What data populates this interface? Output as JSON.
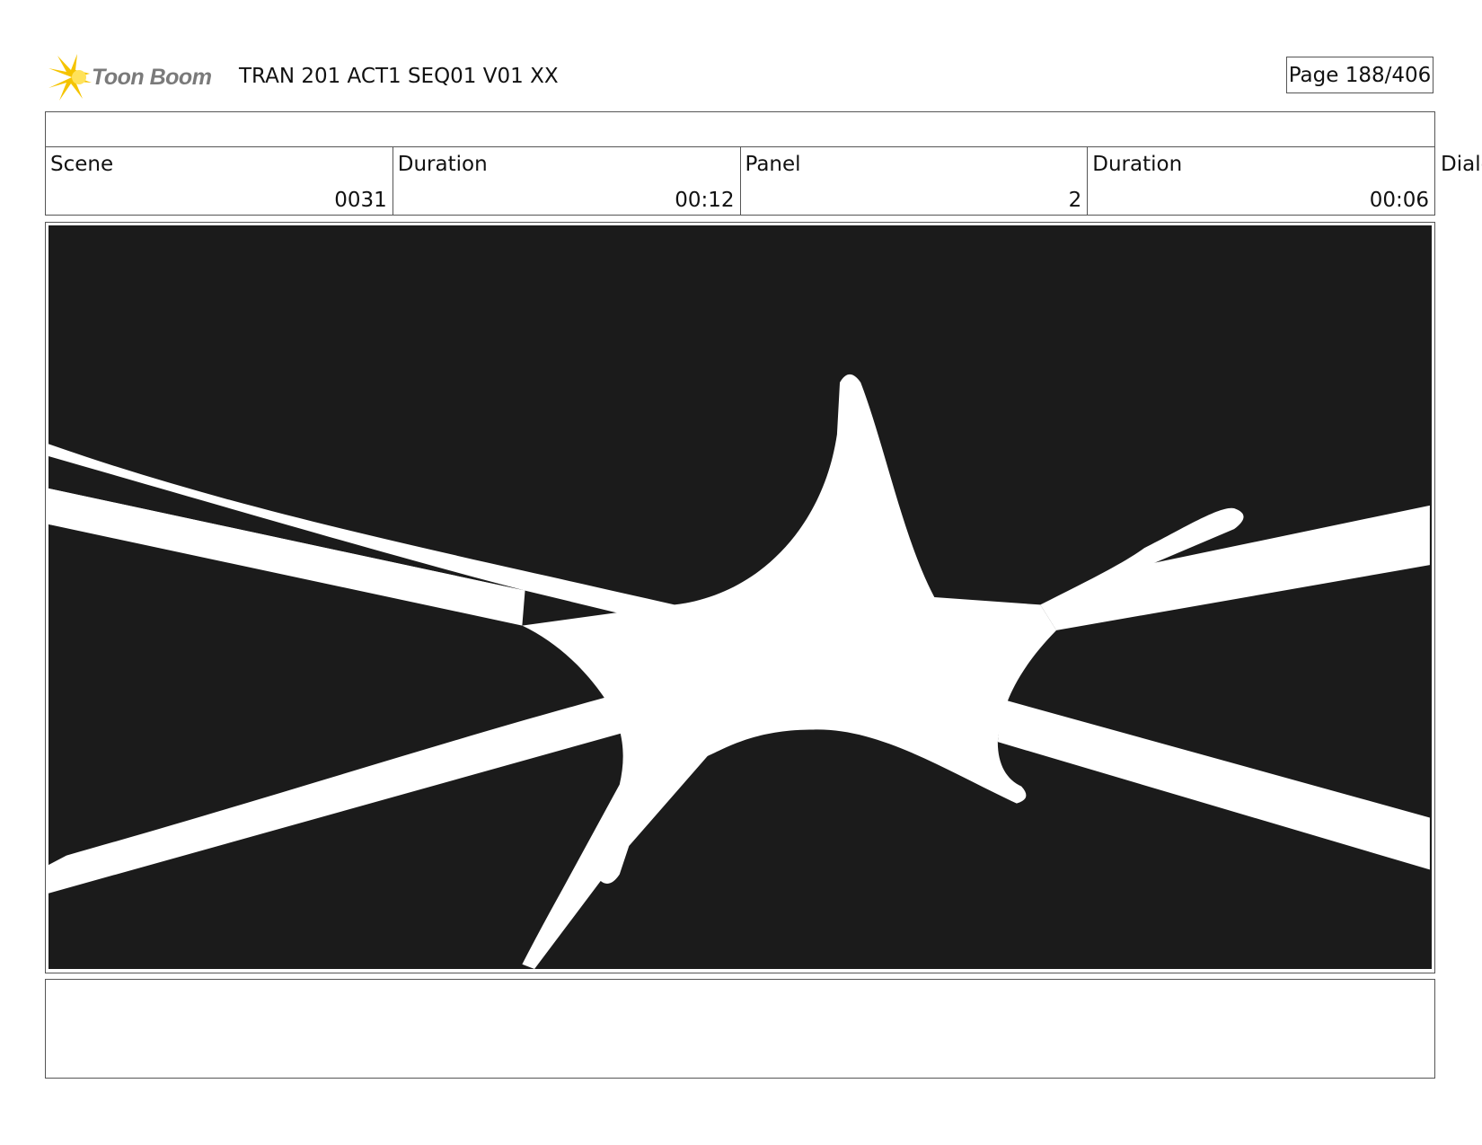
{
  "header": {
    "logo_text": "Toon Boom",
    "title": "TRAN 201 ACT1 SEQ01 V01 XX",
    "page": "Page 188/406"
  },
  "info": {
    "cells": [
      {
        "label": "Scene",
        "value": "0031"
      },
      {
        "label": "Duration",
        "value": "00:12"
      },
      {
        "label": "Panel",
        "value": "2"
      },
      {
        "label": "Duration",
        "value": "00:06"
      }
    ],
    "dialog_label": "Dialo"
  },
  "colors": {
    "panel_bg": "#1b1b1b",
    "logo_accent": "#f5c400",
    "logo_text": "#7a7a7a"
  }
}
